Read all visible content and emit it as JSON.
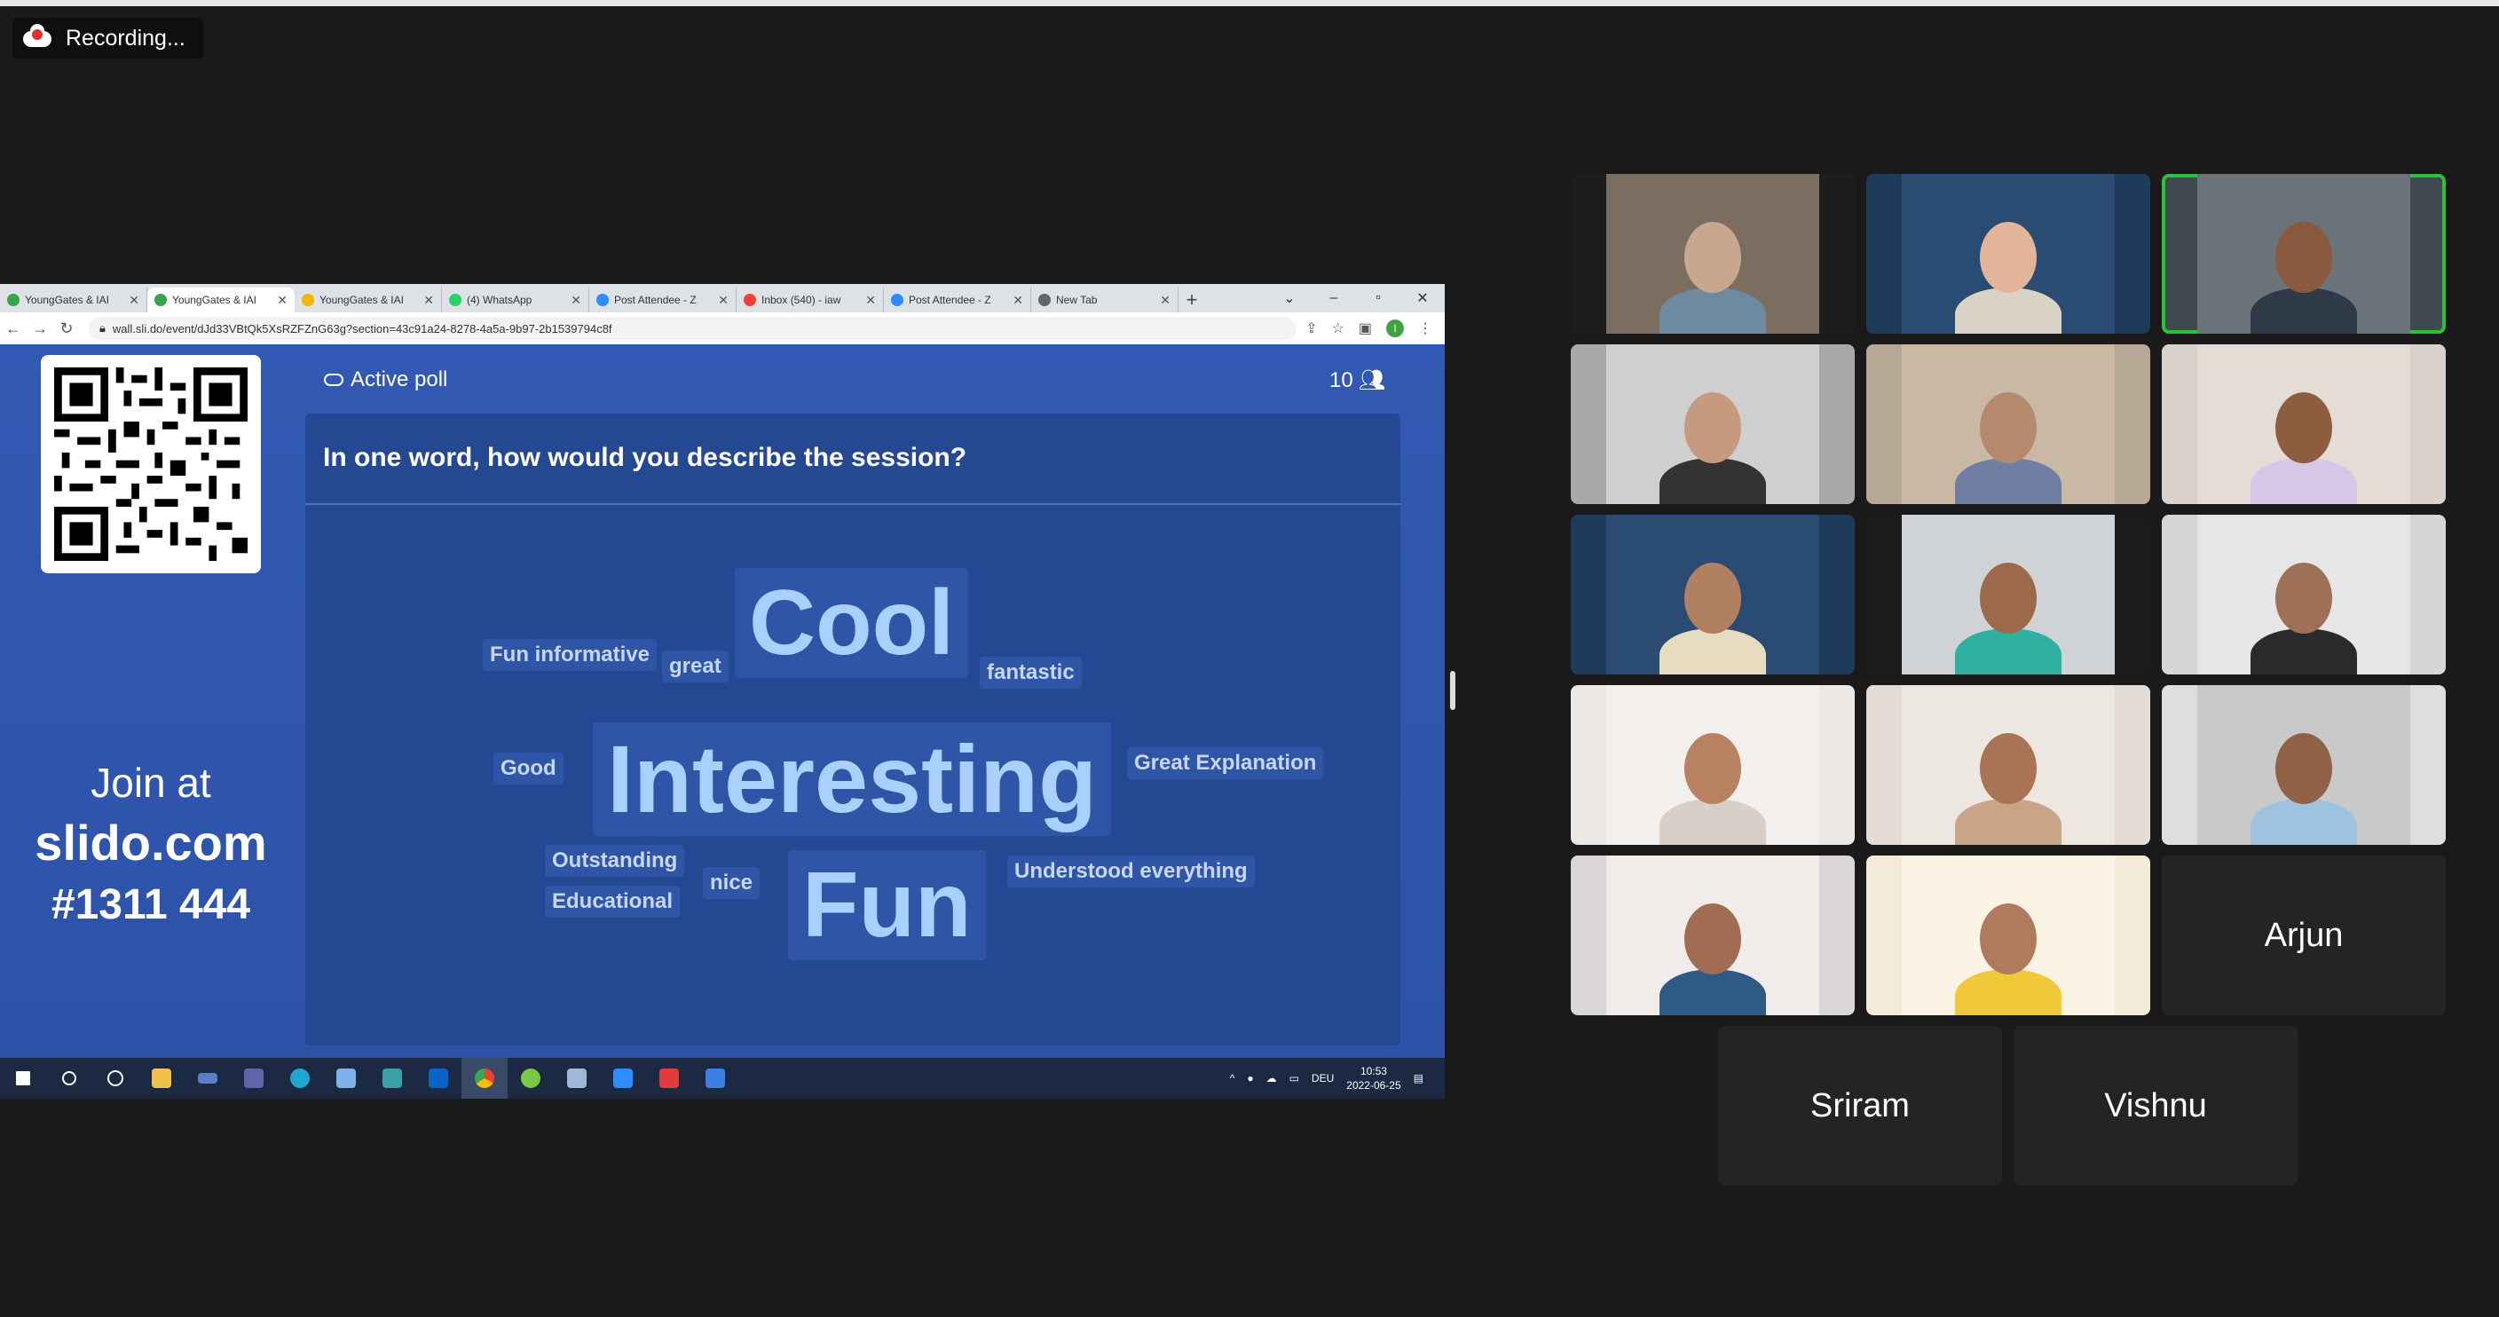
{
  "recording": {
    "label": "Recording..."
  },
  "browser": {
    "tabs": [
      {
        "label": "YoungGates & IAI",
        "color": "#37a34a"
      },
      {
        "label": "YoungGates & IAI",
        "color": "#37a34a"
      },
      {
        "label": "YoungGates & IAI",
        "color": "#f4b400"
      },
      {
        "label": "(4) WhatsApp",
        "color": "#25d366"
      },
      {
        "label": "Post Attendee - Z",
        "color": "#2d8cff"
      },
      {
        "label": "Inbox (540) - iaw",
        "color": "#ea4335"
      },
      {
        "label": "Post Attendee - Z",
        "color": "#2d8cff"
      },
      {
        "label": "New Tab",
        "color": "#666666"
      }
    ],
    "url": "wall.sli.do/event/dJd33VBtQk5XsRZFZnG63g?section=43c91a24-8278-4a5a-9b97-2b1539794c8f"
  },
  "slido": {
    "status": "Active poll",
    "participant_count": "10",
    "join_line1": "Join at",
    "join_line2": "slido.com",
    "join_code": "#1311 444",
    "question": "In one word, how would you describe the session?",
    "words": [
      {
        "text": "Cool",
        "size": 104,
        "big": true
      },
      {
        "text": "Interesting",
        "size": 108,
        "big": true
      },
      {
        "text": "Fun",
        "size": 104,
        "big": true
      },
      {
        "text": "Fun informative",
        "size": 24
      },
      {
        "text": "great",
        "size": 24
      },
      {
        "text": "fantastic",
        "size": 24
      },
      {
        "text": "Good",
        "size": 24
      },
      {
        "text": "Great Explanation",
        "size": 24
      },
      {
        "text": "Outstanding",
        "size": 24
      },
      {
        "text": "Educational",
        "size": 24
      },
      {
        "text": "nice",
        "size": 24
      },
      {
        "text": "Understood everything",
        "size": 24
      }
    ]
  },
  "taskbar": {
    "lang": "DEU",
    "time": "10:53",
    "date": "2022-06-25"
  },
  "participants": {
    "names": [
      "Arjun",
      "Sriram",
      "Vishnu"
    ]
  }
}
